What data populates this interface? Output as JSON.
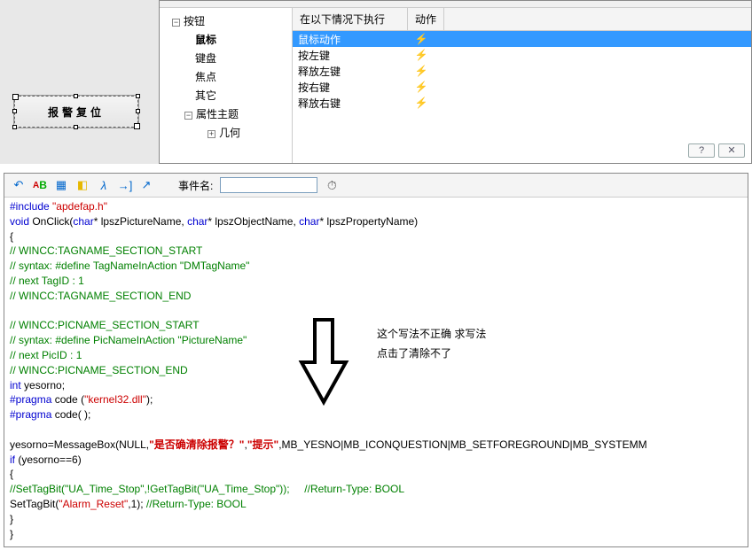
{
  "canvas": {
    "button_label": "报警复位"
  },
  "tree": {
    "root": "按钮",
    "items": [
      "鼠标",
      "键盘",
      "焦点",
      "其它"
    ],
    "theme": "属性主题",
    "geom": "几何"
  },
  "actions": {
    "header_col1": "在以下情况下执行",
    "header_col2": "动作",
    "rows": [
      "鼠标动作",
      "按左键",
      "释放左键",
      "按右键",
      "释放右键"
    ]
  },
  "helpclose": {
    "help": "?",
    "close": "✕"
  },
  "toolbar": {
    "event_label": "事件名:",
    "event_value": ""
  },
  "code": {
    "l1a": "#include",
    "l1b": "\"apdefap.h\"",
    "l2a": "void",
    "l2b": " OnClick(",
    "l2c": "char",
    "l2d": "* lpszPictureName, ",
    "l2e": "char",
    "l2f": "* lpszObjectName, ",
    "l2g": "char",
    "l2h": "* lpszPropertyName)",
    "l3": "{",
    "l4": "// WINCC:TAGNAME_SECTION_START",
    "l5": "// syntax: #define TagNameInAction \"DMTagName\"",
    "l6": "// next TagID : 1",
    "l7": "// WINCC:TAGNAME_SECTION_END",
    "l8": "// WINCC:PICNAME_SECTION_START",
    "l9": "// syntax: #define PicNameInAction \"PictureName\"",
    "l10": "// next PicID : 1",
    "l11": "// WINCC:PICNAME_SECTION_END",
    "l12a": "int",
    "l12b": " yesorno;",
    "l13a": "#pragma",
    "l13b": " code (",
    "l13c": "\"kernel32.dll\"",
    "l13d": ");",
    "l14a": "#pragma",
    "l14b": " code( );",
    "l15a": "yesorno=MessageBox(NULL,",
    "l15b": "\"是否确清除报警？\"",
    "l15c": ",",
    "l15d": "\"提示\"",
    "l15e": ",MB_YESNO|MB_ICONQUESTION|MB_SETFOREGROUND|MB_SYSTEMM",
    "l16a": "if",
    "l16b": " (yesorno==6)",
    "l17": "{",
    "l18a": "//SetTagBit(\"UA_Time_Stop\",!GetTagBit(\"UA_Time_Stop\"));",
    "l18b": "//Return-Type: BOOL",
    "l19a": "SetTagBit(",
    "l19b": "\"Alarm_Reset\"",
    "l19c": ",1);     ",
    "l19d": "//Return-Type: BOOL",
    "l20": "}",
    "l21": "}"
  },
  "annotation": {
    "line1": "这个写法不正确 求写法",
    "line2": "点击了清除不了"
  }
}
